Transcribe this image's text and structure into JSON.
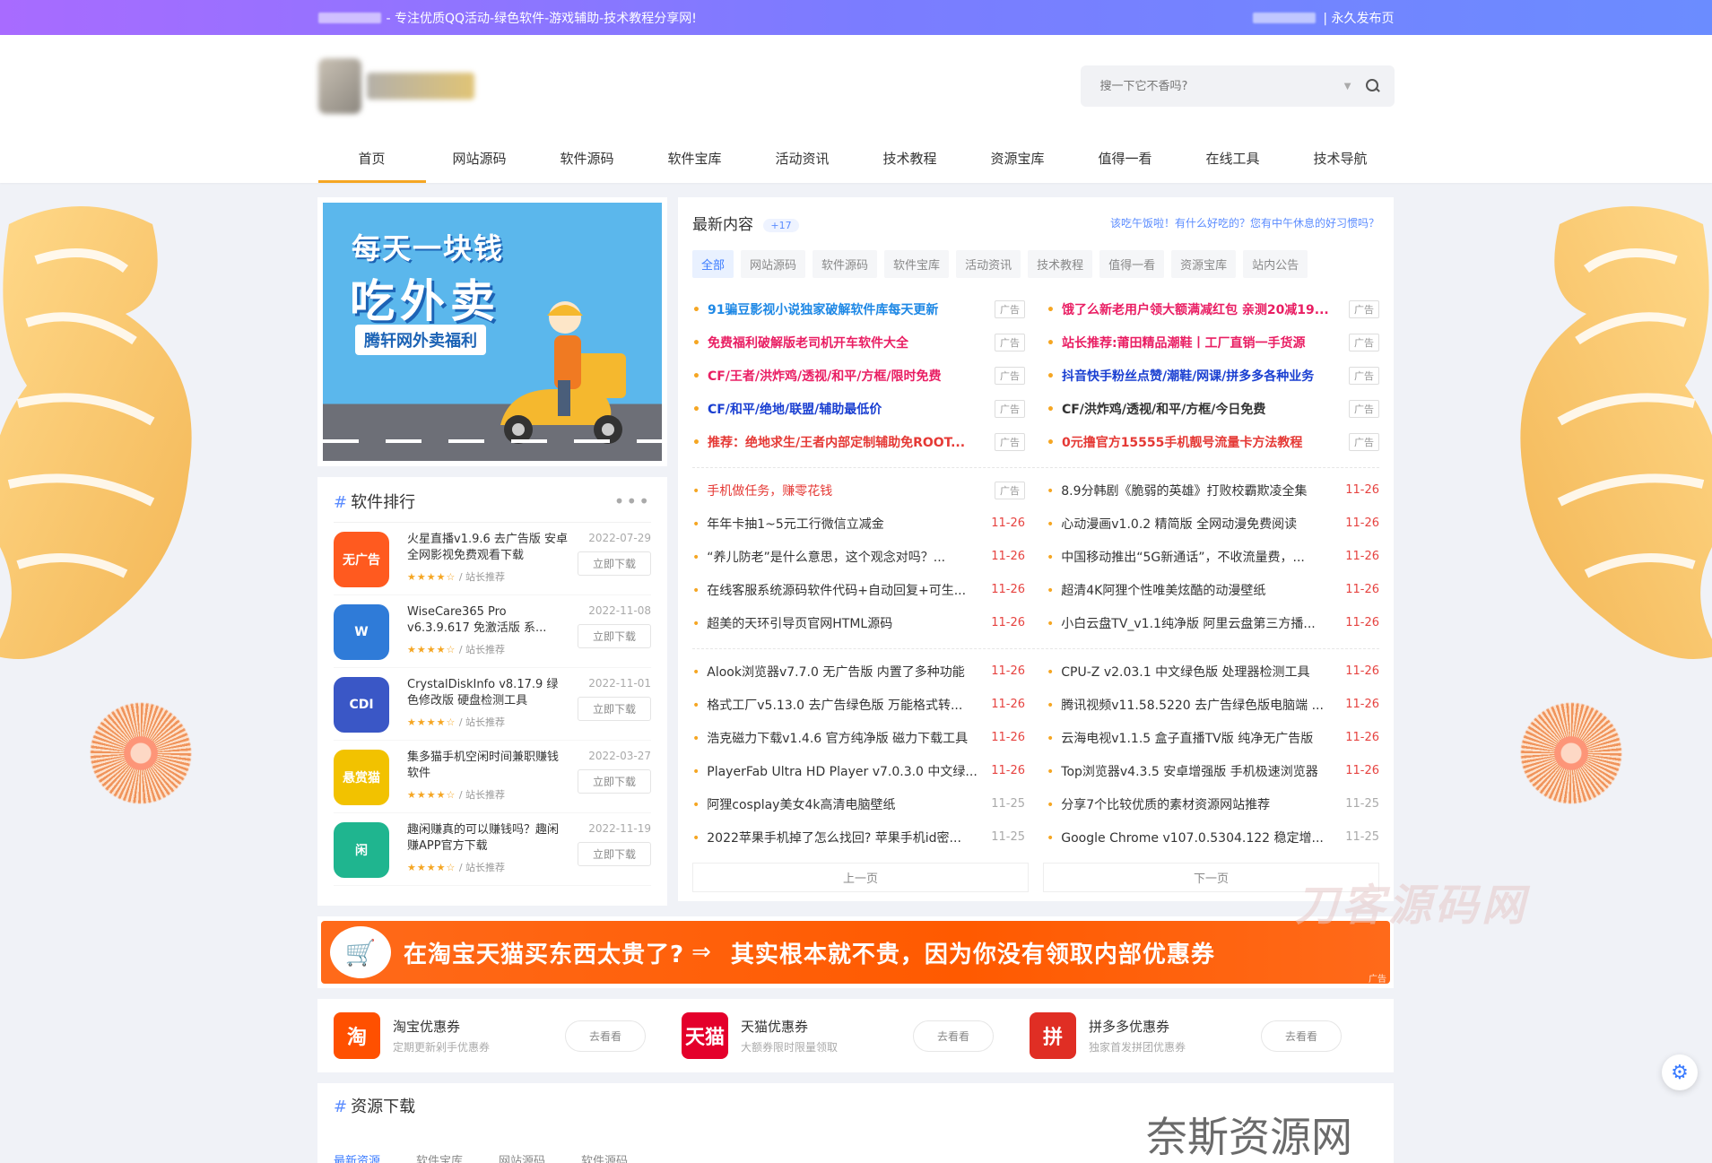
{
  "topbar": {
    "slogan": "- 专注优质QQ活动-绿色软件-游戏辅助-技术教程分享网!",
    "right_link": "| 永久发布页"
  },
  "search": {
    "placeholder": "搜一下它不香吗?"
  },
  "nav": [
    "首页",
    "网站源码",
    "软件源码",
    "软件宝库",
    "活动资讯",
    "技术教程",
    "资源宝库",
    "值得一看",
    "在线工具",
    "技术导航"
  ],
  "banner": {
    "line1": "每天一块钱",
    "line2": "吃外卖",
    "line3": "腾轩网外卖福利"
  },
  "rank": {
    "title": "软件排行",
    "items": [
      {
        "name": "火星直播v1.9.6 去广告版 安卓全网影视免费观看下载",
        "date": "2022-07-29",
        "btn": "立即下载",
        "by": "/ 站长推荐",
        "stars": "★★★★☆",
        "icon_label": "无广告",
        "color": "#ff5a1f"
      },
      {
        "name": "WiseCare365 Pro v6.3.9.617 免激活版 系...",
        "date": "2022-11-08",
        "btn": "立即下载",
        "by": "/ 站长推荐",
        "stars": "★★★★☆",
        "icon_label": "W",
        "color": "#2f7bd8"
      },
      {
        "name": "CrystalDiskInfo v8.17.9 绿色修改版 硬盘检测工具",
        "date": "2022-11-01",
        "btn": "立即下载",
        "by": "/ 站长推荐",
        "stars": "★★★★☆",
        "icon_label": "CDI",
        "color": "#3a57c6"
      },
      {
        "name": "集多猫手机空闲时间兼职赚钱软件",
        "date": "2022-03-27",
        "btn": "立即下载",
        "by": "/ 站长推荐",
        "stars": "★★★★☆",
        "icon_label": "悬赏猫",
        "color": "#f2c200"
      },
      {
        "name": "趣闲赚真的可以赚钱吗？趣闲赚APP官方下载",
        "date": "2022-11-19",
        "btn": "立即下载",
        "by": "/ 站长推荐",
        "stars": "★★★★☆",
        "icon_label": "闲",
        "color": "#1fb58f"
      }
    ]
  },
  "latest": {
    "title": "最新内容",
    "count": "+17",
    "notice": "该吃午饭啦！有什么好吃的？您有中午休息的好习惯吗？",
    "tabs": [
      "全部",
      "网站源码",
      "软件源码",
      "软件宝库",
      "活动资讯",
      "技术教程",
      "值得一看",
      "资源宝库",
      "站内公告"
    ],
    "ads": [
      {
        "t": "91骗豆影视小说独家破解软件库每天更新",
        "c": "#1e88e5",
        "tag": "广告"
      },
      {
        "t": "饿了么新老用户领大额满减红包 亲测20减19...",
        "c": "#e91e63",
        "tag": "广告"
      },
      {
        "t": "免费福利破解版老司机开车软件大全",
        "c": "#e91e63",
        "tag": "广告"
      },
      {
        "t": "站长推荐:莆田精品潮鞋丨工厂直销一手货源",
        "c": "#e91e63",
        "tag": "广告"
      },
      {
        "t": "CF/王者/洪炸鸡/透视/和平/方框/限时免费",
        "c": "#e91e63",
        "tag": "广告"
      },
      {
        "t": "抖音快手粉丝点赞/潮鞋/网课/拼多多各种业务",
        "c": "#1a3fd1",
        "tag": "广告"
      },
      {
        "t": "CF/和平/绝地/联盟/辅助最低价",
        "c": "#1a3fd1",
        "tag": "广告"
      },
      {
        "t": "CF/洪炸鸡/透视/和平/方框/今日免费",
        "c": "#333333",
        "tag": "广告"
      },
      {
        "t": "推荐：绝地求生/王者内部定制辅助免ROOT...",
        "c": "#e53935",
        "tag": "广告"
      },
      {
        "t": "0元撸官方15555手机靓号流量卡方法教程",
        "c": "#e53935",
        "tag": "广告"
      }
    ],
    "group2": [
      {
        "t": "手机做任务，赚零花钱",
        "d": "广告",
        "red": true,
        "ad": true
      },
      {
        "t": "8.9分韩剧《脆弱的英雄》打败校霸欺凌全集",
        "d": "11-26"
      },
      {
        "t": "年年卡抽1~5元工行微信立减金",
        "d": "11-26"
      },
      {
        "t": "心动漫画v1.0.2 精简版 全网动漫免费阅读",
        "d": "11-26"
      },
      {
        "t": "“养儿防老”是什么意思，这个观念对吗？...",
        "d": "11-26"
      },
      {
        "t": "中国移动推出“5G新通话”，不收流量费，...",
        "d": "11-26"
      },
      {
        "t": "在线客服系统源码软件代码+自动回复+可生...",
        "d": "11-26"
      },
      {
        "t": "超清4K阿狸个性唯美炫酷的动漫壁纸",
        "d": "11-26"
      },
      {
        "t": "超美的天环引导页官网HTML源码",
        "d": "11-26"
      },
      {
        "t": "小白云盘TV_v1.1纯净版 阿里云盘第三方播...",
        "d": "11-26"
      }
    ],
    "group3": [
      {
        "t": "Alook浏览器v7.7.0 无广告版 内置了多种功能",
        "d": "11-26"
      },
      {
        "t": "CPU-Z v2.03.1 中文绿色版 处理器检测工具",
        "d": "11-26"
      },
      {
        "t": "格式工厂v5.13.0 去广告绿色版 万能格式转...",
        "d": "11-26"
      },
      {
        "t": "腾讯视频v11.58.5220 去广告绿色版电脑端 ...",
        "d": "11-26"
      },
      {
        "t": "浩克磁力下载v1.4.6 官方纯净版 磁力下载工具",
        "d": "11-26"
      },
      {
        "t": "云海电视v1.1.5 盒子直播TV版 纯净无广告版",
        "d": "11-26"
      },
      {
        "t": "PlayerFab Ultra HD Player v7.0.3.0 中文绿...",
        "d": "11-26"
      },
      {
        "t": "Top浏览器v4.3.5 安卓增强版 手机极速浏览器",
        "d": "11-26"
      },
      {
        "t": "阿狸cosplay美女4k高清电脑壁纸",
        "d": "11-25",
        "gray": true
      },
      {
        "t": "分享7个比较优质的素材资源网站推荐",
        "d": "11-25",
        "gray": true
      },
      {
        "t": "2022苹果手机掉了怎么找回? 苹果手机id密...",
        "d": "11-25",
        "gray": true
      },
      {
        "t": "Google Chrome v107.0.5304.122 稳定增...",
        "d": "11-25",
        "gray": true
      }
    ],
    "prev": "上一页",
    "next": "下一页"
  },
  "promo": {
    "left": "在淘宝天猫买东西太贵了?",
    "right": "其实根本就不贵，因为你没有领取内部优惠券",
    "tag": "广告"
  },
  "coupons": [
    {
      "icon": "淘",
      "name": "淘宝优惠券",
      "sub": "定期更新剁手优惠券",
      "btn": "去看看",
      "color": "#ff5000"
    },
    {
      "icon": "天猫",
      "name": "天猫优惠券",
      "sub": "大额券限时限量领取",
      "btn": "去看看",
      "color": "#e4002b"
    },
    {
      "icon": "拼",
      "name": "拼多多优惠券",
      "sub": "独家首发拼团优惠券",
      "btn": "去看看",
      "color": "#e02e24"
    }
  ],
  "resources": {
    "title": "资源下载",
    "tabs": [
      "最新资源",
      "软件宝库",
      "网站源码",
      "软件源码"
    ]
  },
  "watermarks": {
    "a": "刀客源码网",
    "b": "奈斯资源网www.nicezyw.com"
  }
}
